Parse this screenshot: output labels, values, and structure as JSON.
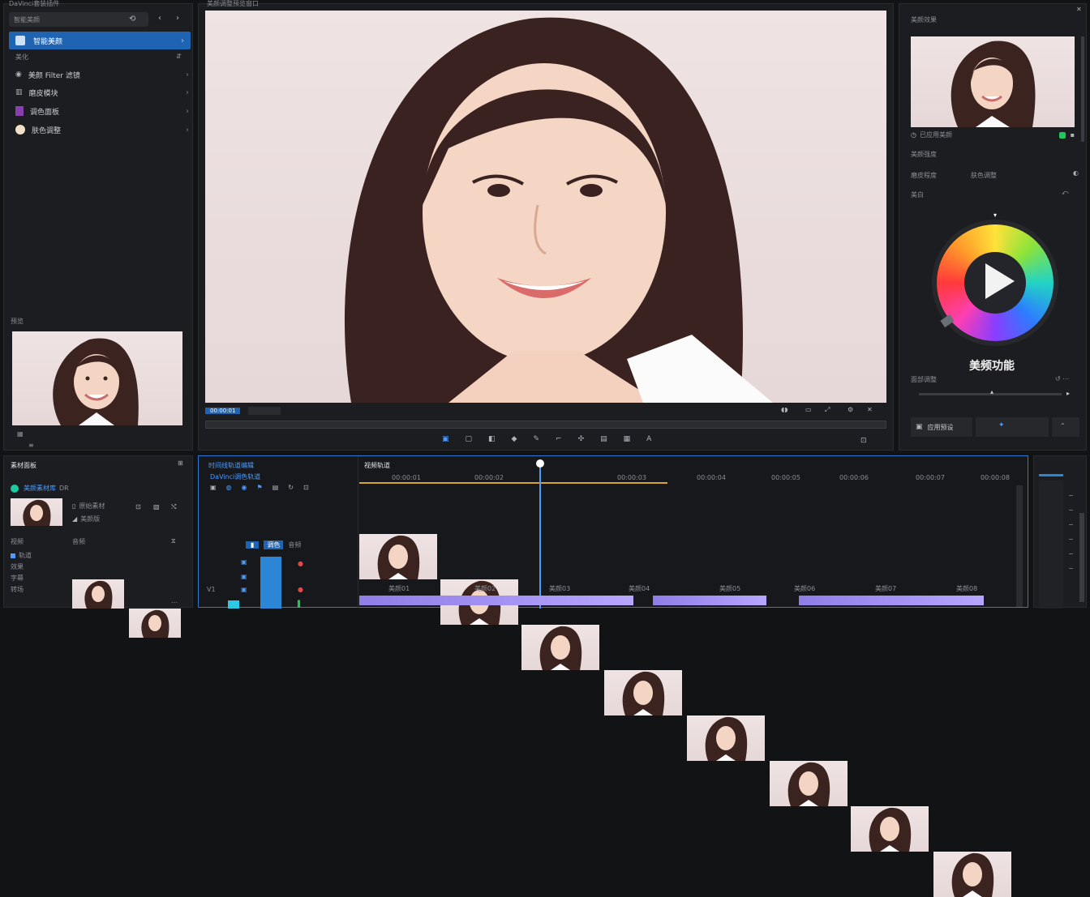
{
  "left_panel": {
    "header_title": "DaVinci套装插件",
    "search_icons": [
      "refresh-icon",
      "back-icon",
      "forward-icon"
    ],
    "items": [
      {
        "label": "智能美颜",
        "selected": true
      },
      {
        "label": "美颜 Filter 滤镜"
      },
      {
        "label": "磨皮模块"
      },
      {
        "label": "调色面板"
      },
      {
        "label": "肤色调整"
      }
    ],
    "sub_label_left": "美化",
    "preview_label": "预览"
  },
  "viewer": {
    "title": "美颜调整预览窗口",
    "timecode": "00:00:01",
    "toolbar_icons": [
      "select-icon",
      "trim-icon",
      "blade-icon",
      "marker-icon",
      "pen-icon",
      "crop-icon",
      "transform-icon",
      "camera-icon",
      "grid-icon",
      "text-icon",
      "expand-icon"
    ]
  },
  "right_panel": {
    "title": "美颜效果",
    "preview_caption": "已应用美颜",
    "section_beauty": "美颜强度",
    "section_smooth": "磨皮程度",
    "section_tone": "肤色调整",
    "section_label": "美白",
    "wheel_title": "美频功能",
    "slider_label": "面部调整",
    "apply_button": "应用预设",
    "accent_color": "#1ec95b"
  },
  "media_panel": {
    "title": "素材面板",
    "badge": "美颜素材库",
    "badge_suffix": "DR",
    "clip_name": "原始素材",
    "clip_sub": "美颜版",
    "col1": "视频",
    "col2": "音频",
    "list": [
      "轨道",
      "效果",
      "字幕",
      "转场"
    ]
  },
  "timeline": {
    "title": "时间线轨道编辑",
    "subtitle": "DaVinci调色轨道",
    "track_header": "视频轨道",
    "tab1": "调色",
    "tab2": "音频",
    "ruler": [
      "00:00:01",
      "00:00:02",
      "00:00:03",
      "00:00:04",
      "00:00:05",
      "00:00:06",
      "00:00:07",
      "00:00:08"
    ],
    "clip_labels": [
      "美颜01",
      "美颜02",
      "美颜03",
      "美颜04",
      "美颜05",
      "美颜06",
      "美颜07",
      "美颜08"
    ],
    "track_label": "V1"
  }
}
